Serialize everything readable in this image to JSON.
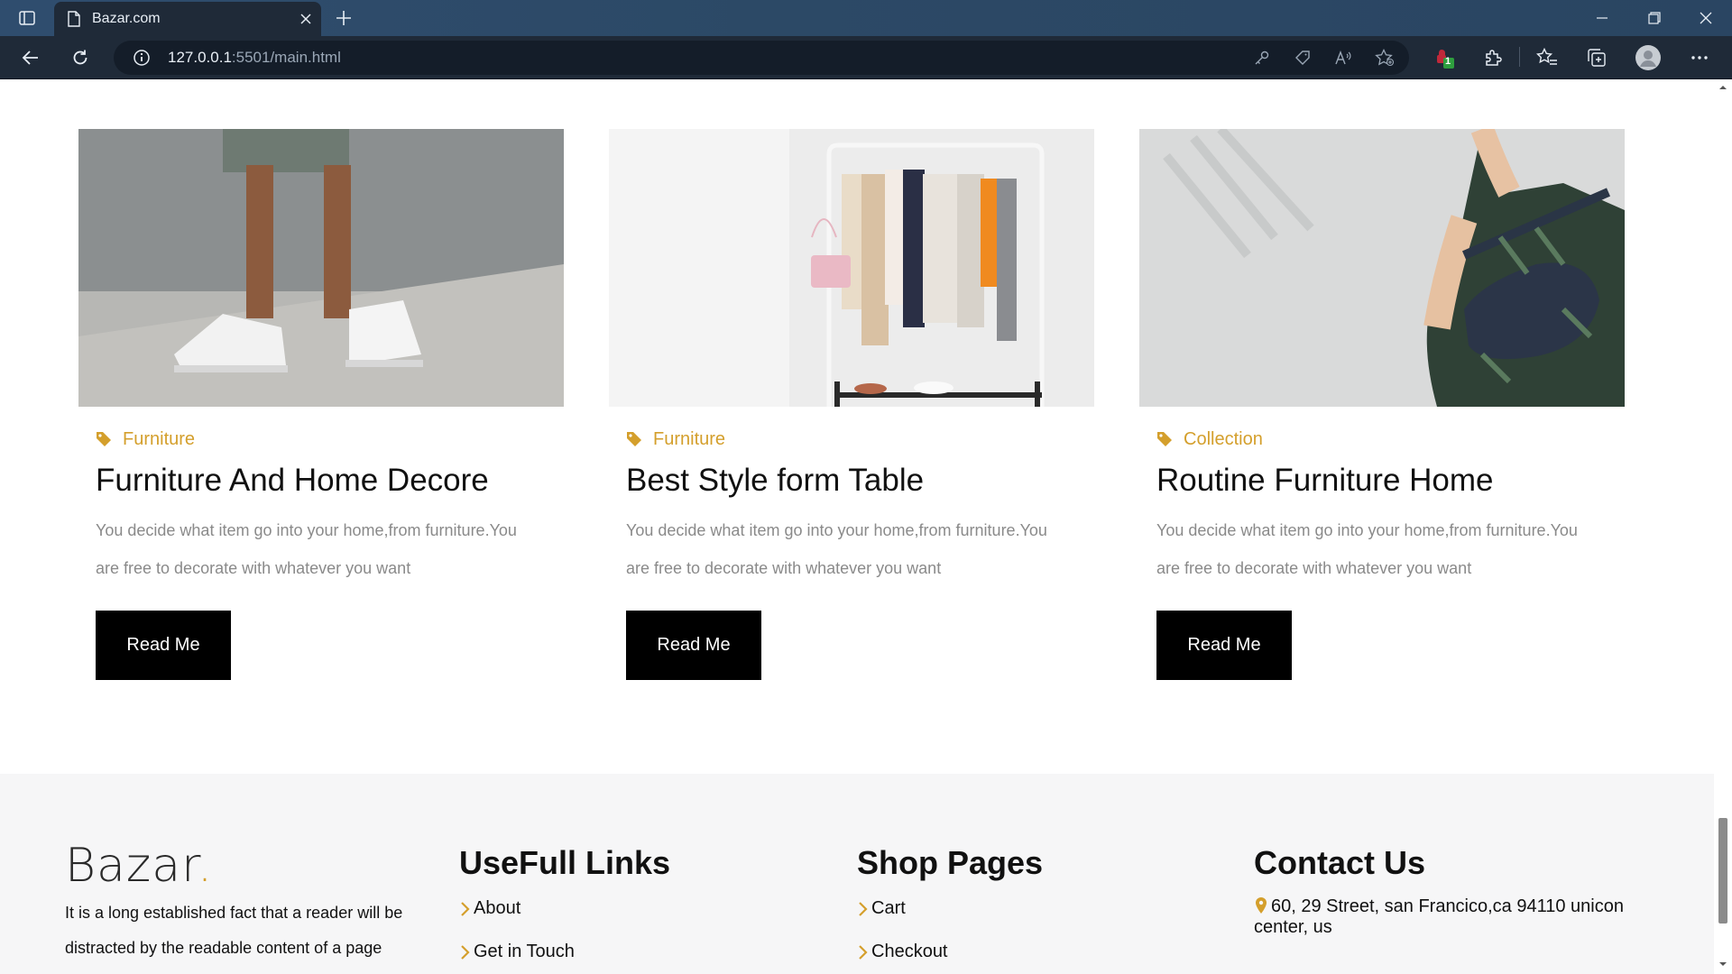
{
  "browser": {
    "tab_title": "Bazar.com",
    "url_host": "127.0.0.1",
    "url_rest": ":5501/main.html",
    "extension_badge": "1"
  },
  "cards": [
    {
      "tag": "Furniture",
      "title": "Furniture And Home Decore",
      "text": "You decide what item go into your home,from furniture.You are free to decorate with whatever you want",
      "button": "Read Me",
      "image": "white-sneakers-street-photo"
    },
    {
      "tag": "Furniture",
      "title": "Best Style form Table",
      "text": "You decide what item go into your home,from furniture.You are free to decorate with whatever you want",
      "button": "Read Me",
      "image": "clothing-rack-photo"
    },
    {
      "tag": "Collection",
      "title": "Routine Furniture Home",
      "text": "You decide what item go into your home,from furniture.You are free to decorate with whatever you want",
      "button": "Read Me",
      "image": "man-with-waist-bag-photo"
    }
  ],
  "footer": {
    "logo": "Bazar",
    "logo_dot": ".",
    "about_text": "It is a long established fact that a reader will be distracted by the readable content of a page",
    "useful_links": {
      "heading": "UseFull Links",
      "links": [
        "About",
        "Get in Touch"
      ]
    },
    "shop_pages": {
      "heading": "Shop Pages",
      "links": [
        "Cart",
        "Checkout"
      ]
    },
    "contact": {
      "heading": "Contact Us",
      "address": "60, 29 Street, san Francico,ca 94110 unicon center, us"
    }
  },
  "colors": {
    "accent": "#d49f2c",
    "button_bg": "#000000",
    "footer_bg": "#f6f6f7",
    "body_text_muted": "#8a8a8a"
  }
}
